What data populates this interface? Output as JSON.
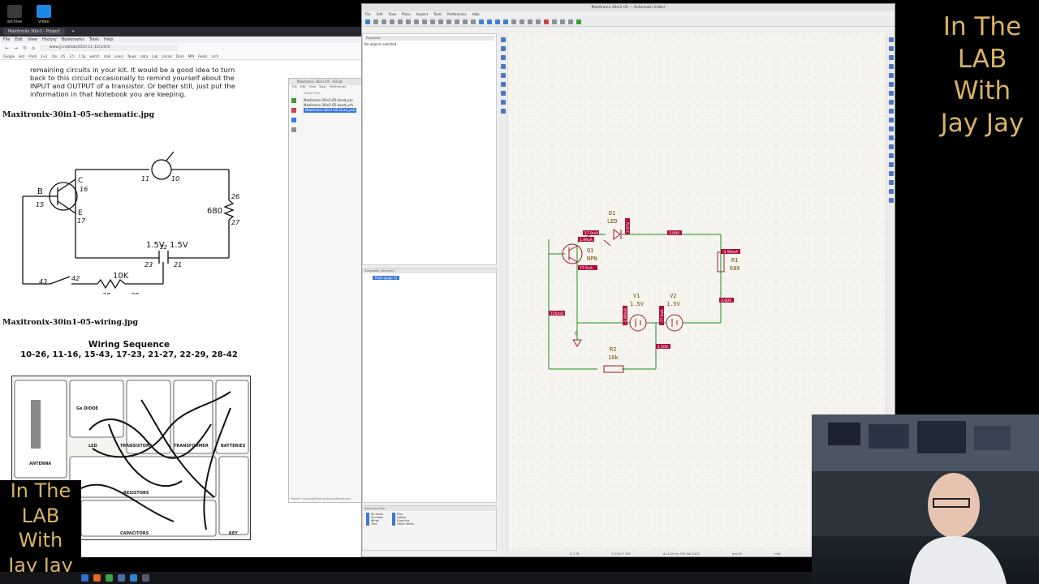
{
  "desktop": {
    "icons": [
      {
        "label": "archive",
        "icon": "terminal-icon",
        "color": "#3a3a3a"
      },
      {
        "label": "video",
        "icon": "folder-icon",
        "color": "#1e88e5"
      }
    ]
  },
  "overlay": {
    "title_lines": [
      "In The",
      "LAB",
      "With",
      "Jay Jay"
    ],
    "color": "#d8b264"
  },
  "browser": {
    "tab_label": "Maxitronix 30in1 - Project",
    "menu": [
      "File",
      "Edit",
      "View",
      "History",
      "Bookmarks",
      "Tools",
      "Help"
    ],
    "url": "www.jjl.net/lab/2025-11-12/1/4/1/",
    "bookmarks": [
      "Google",
      "Hot",
      "Prodi",
      "2+2",
      "1to",
      "b5",
      "3.5",
      "1.5p",
      "watch",
      "mail",
      "Learn",
      "News",
      "data",
      "Lab",
      "LAcad",
      "DLim",
      "MM",
      "Feeds",
      "arch"
    ],
    "paragraph": "remaining circuits in your kit. It would be a good idea to turn back to this circuit occasionally to remind yourself about the INPUT and OUTPUT of a transistor. Or better still, just put the information in that Notebook you are keeping.",
    "schematic_heading": "Maxitronix-30in1-05-schematic.jpg",
    "wiring_heading": "Maxitronix-30in1-05-wiring.jpg",
    "wiring_title": "Wiring Sequence",
    "wiring_sequence": "10-26, 11-16, 15-43, 17-23, 21-27, 22-29, 28-42",
    "old_schematic": {
      "labels": [
        "B",
        "C",
        "E",
        "16",
        "15",
        "17",
        "11",
        "10",
        "680",
        "26",
        "27",
        "1.5V",
        "1.5V",
        "22",
        "23",
        "21",
        "10K",
        "43",
        "42",
        "28",
        "29"
      ]
    },
    "wiring_board": {
      "labels": [
        "Ge DIODE",
        "LED",
        "TRANSISTORS",
        "TRANSFORMER",
        "BATTERIES",
        "RESISTORS",
        "CAPACITORS",
        "KEY",
        "ANTENNA"
      ]
    }
  },
  "project_manager": {
    "title": "Maxitronix 30in1-05 - KiCad",
    "menu": [
      "File",
      "Edit",
      "View",
      "Tools",
      "Preferences"
    ],
    "panel_title": "Project Files",
    "tree": [
      "Maxitronix-30in1-05.kicad_pro",
      "Maxitronix-30in1-05.kicad_sch",
      "Maxitronix-30in1-05.kicad_pcb"
    ],
    "status": "Project: /home/jj/Desktop/kicad/Maxitronix"
  },
  "schematic_editor": {
    "title": "Maxitronix-30in1-05 — Schematic Editor",
    "menu": [
      "File",
      "Edit",
      "View",
      "Place",
      "Inspect",
      "Tools",
      "Preferences",
      "Help"
    ],
    "properties_header": "Properties",
    "no_selection": "No objects selected",
    "hierarchy_header": "Schematic Hierarchy",
    "root_node": "Root (page 1)",
    "filter_header": "Selection Filter",
    "filters": [
      "All items",
      "Pins",
      "Symbols",
      "Labels",
      "Wires",
      "Graphics",
      "Text",
      "Other items"
    ],
    "status_items": [
      "Z 3.78",
      "X 1100 Y 950",
      "dx 1100 dy 950 dist 1453",
      "grid 50",
      "mils",
      "Select"
    ],
    "circuit": {
      "components": [
        {
          "ref": "D1",
          "value": "LED"
        },
        {
          "ref": "Q1",
          "value": "NPN"
        },
        {
          "ref": "R1",
          "value": "680"
        },
        {
          "ref": "V1",
          "value": "1.5V"
        },
        {
          "ref": "V2",
          "value": "1.5V"
        },
        {
          "ref": "R2",
          "value": "10k"
        }
      ],
      "net_labels": [
        "3.00V",
        "3.00V",
        "1.50V",
        "0"
      ],
      "probe_labels": [
        "17.9mV",
        "1.99uA",
        "2.97V",
        "77.5uA",
        "725mV",
        "-2.99mA",
        "-1.99mA",
        "-77.5uA"
      ]
    }
  },
  "webcam": {
    "description_colors": [
      "#3b4350",
      "#141920"
    ]
  },
  "taskbar": {
    "icons": [
      {
        "name": "launcher-icon",
        "color": "#2f6fcf"
      },
      {
        "name": "firefox-icon",
        "color": "#e66a1f"
      },
      {
        "name": "terminal-icon",
        "color": "#3fa34d"
      },
      {
        "name": "files-icon",
        "color": "#4a6ea8"
      },
      {
        "name": "vscode-icon",
        "color": "#2a86d6"
      },
      {
        "name": "kicad-icon",
        "color": "#5a5a70"
      }
    ]
  }
}
